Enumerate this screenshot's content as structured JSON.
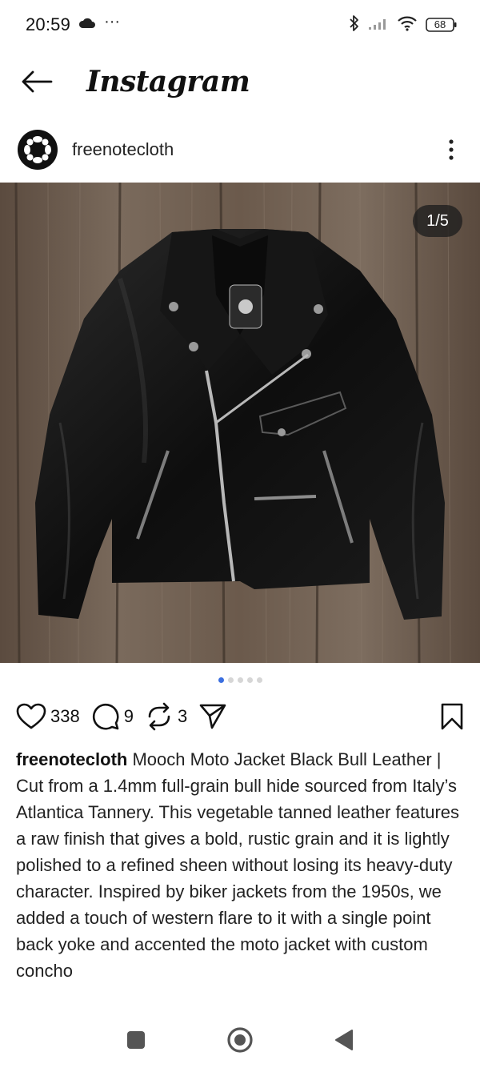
{
  "status_bar": {
    "time": "20:59",
    "extra": "···",
    "battery": "68"
  },
  "header": {
    "title": "Instagram"
  },
  "post": {
    "username": "freenotecloth",
    "page_indicator": "1/5",
    "carousel_index": 1,
    "carousel_total": 5,
    "likes": "338",
    "comments": "9",
    "reposts": "3",
    "caption_user": "freenotecloth",
    "caption_text": "Mooch Moto Jacket Black Bull Leather | Cut from a 1.4mm full-grain bull hide sourced from Italy’s Atlantica Tannery. This vegetable tanned leather features a raw finish that gives a bold, rustic grain and it is lightly polished to a refined sheen without losing its heavy-duty character. Inspired by biker jackets from the 1950s, we added a touch of western flare to it with a single point back yoke and accented the moto jacket with custom concho"
  },
  "icons": {
    "status": [
      "cloud-icon",
      "bluetooth-icon",
      "signal-icon",
      "wifi-icon",
      "battery-icon"
    ],
    "header": [
      "back-arrow-icon"
    ],
    "actions": [
      "heart-icon",
      "comment-icon",
      "repost-icon",
      "send-icon",
      "bookmark-icon"
    ],
    "nav": [
      "square-icon",
      "circle-icon",
      "triangle-back-icon"
    ]
  },
  "colors": {
    "accent_dot": "#3b6fe0",
    "text": "#111111"
  }
}
